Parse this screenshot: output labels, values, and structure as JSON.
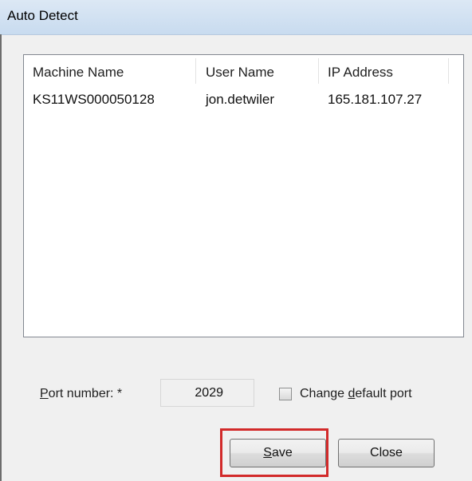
{
  "window": {
    "title": "Auto Detect"
  },
  "table": {
    "headers": [
      "Machine Name",
      "User Name",
      "IP Address"
    ],
    "rows": [
      [
        "KS11WS000050128",
        "jon.detwiler",
        "165.181.107.27"
      ]
    ]
  },
  "port": {
    "label_mnemonic": "P",
    "label_rest": "ort number: *",
    "value": "2029"
  },
  "checkbox": {
    "checked": false,
    "label_pre": "Change ",
    "label_mnemonic": "d",
    "label_post": "efault port"
  },
  "buttons": {
    "save_mnemonic": "S",
    "save_rest": "ave",
    "close_label": "Close"
  },
  "colors": {
    "highlight": "#d22a2a"
  }
}
